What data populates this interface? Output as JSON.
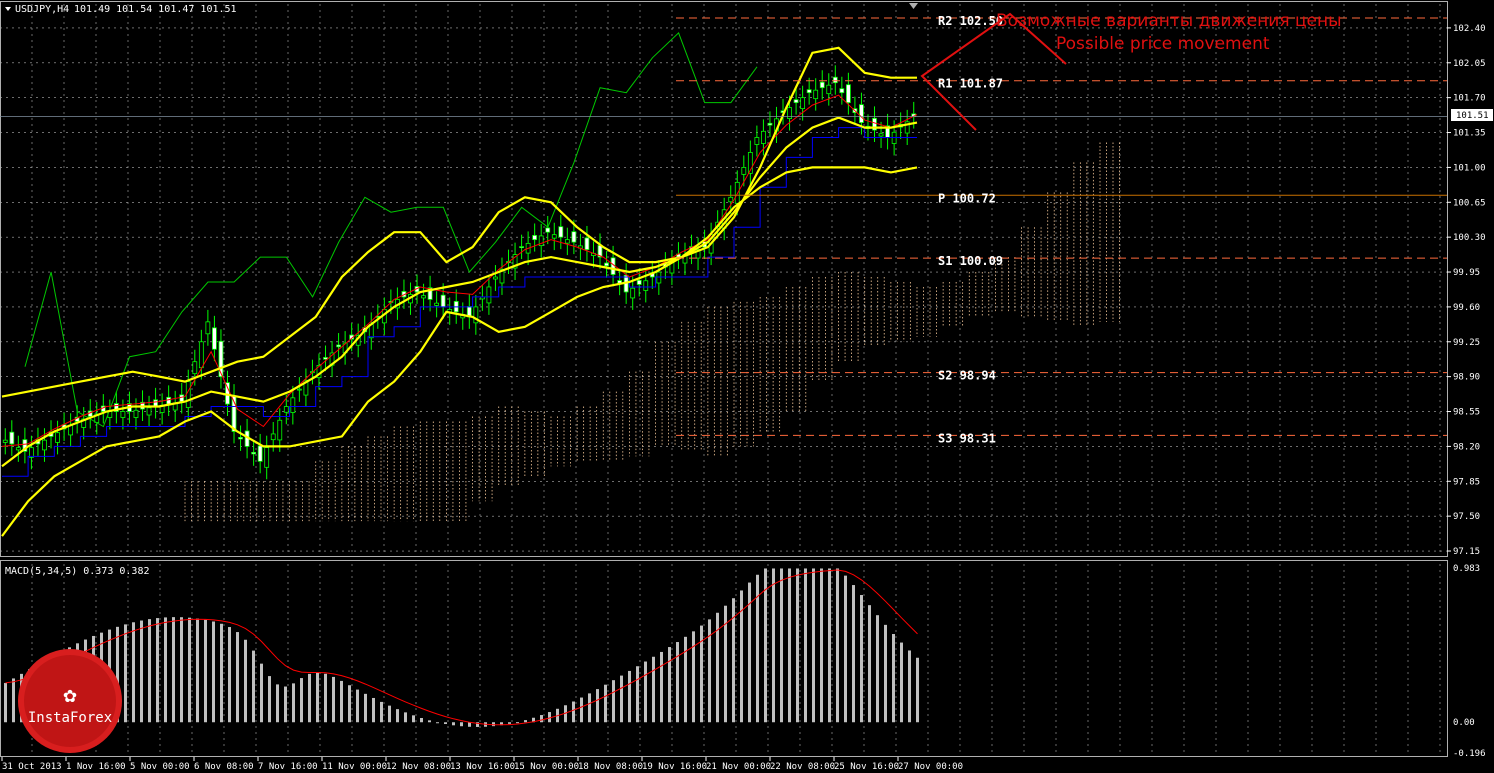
{
  "header": {
    "symbol_label": "USDJPY,H4",
    "ohlc": "101.49 101.54 101.47 101.51"
  },
  "levels": [
    {
      "label": "R2 102.50",
      "value": 102.5
    },
    {
      "label": "R1 101.87",
      "value": 101.87
    },
    {
      "label": "P 100.72",
      "value": 100.72
    },
    {
      "label": "S1 100.09",
      "value": 100.09
    },
    {
      "label": "S2 98.94",
      "value": 98.94
    },
    {
      "label": "S3 98.31",
      "value": 98.31
    }
  ],
  "annotation": {
    "line1": "Возможные варианты движения цены",
    "line2": "Possible price movement",
    "color": "#e01010"
  },
  "current_price": {
    "label": "101.51",
    "value": 101.51
  },
  "macd": {
    "label": "MACD(5,34,5) 0.373 0.382",
    "ticks": [
      "0.983",
      "0.00",
      "-0.196"
    ]
  },
  "logo": {
    "text": "InstaForex"
  },
  "colors": {
    "grid": "#b0b0b0",
    "bollinger": "#ffff00",
    "kijun": "#0000ff",
    "tenkan": "#ff0000",
    "chikou": "#00c800",
    "cloud": "#f5c89a",
    "candle": "#00ff00",
    "pivot": "#c87000",
    "sr": "#ff6a3c",
    "macd_hist": "#c0c0c0",
    "macd_signal": "#ff0000"
  },
  "chart_data": {
    "type": "line",
    "title": "USDJPY,H4",
    "price_axis_ticks": [
      "102.40",
      "102.05",
      "101.70",
      "101.35",
      "101.00",
      "100.65",
      "100.30",
      "99.95",
      "99.60",
      "99.25",
      "98.90",
      "98.55",
      "98.20",
      "97.85",
      "97.50",
      "97.15"
    ],
    "ylim": [
      97.1,
      102.64
    ],
    "x_ticks": [
      "31 Oct 2013",
      "1 Nov 16:00",
      "5 Nov 00:00",
      "6 Nov 08:00",
      "7 Nov 16:00",
      "11 Nov 00:00",
      "12 Nov 08:00",
      "13 Nov 16:00",
      "15 Nov 00:00",
      "18 Nov 08:00",
      "19 Nov 16:00",
      "21 Nov 00:00",
      "22 Nov 08:00",
      "25 Nov 16:00",
      "27 Nov 00:00"
    ],
    "grid": true,
    "series": [
      {
        "name": "Price (close)",
        "values": [
          98.3,
          98.15,
          98.3,
          98.45,
          98.55,
          98.55,
          98.6,
          98.65,
          99.45,
          98.35,
          98.05,
          98.6,
          98.95,
          99.2,
          99.35,
          99.65,
          99.75,
          99.6,
          99.5,
          99.9,
          100.2,
          100.35,
          100.25,
          100.1,
          99.75,
          99.9,
          100.1,
          100.2,
          100.7,
          101.3,
          101.55,
          101.75,
          101.85,
          101.45,
          101.3,
          101.51
        ]
      },
      {
        "name": "Bollinger upper",
        "values": [
          98.7,
          98.75,
          98.8,
          98.85,
          98.9,
          98.95,
          98.9,
          98.85,
          98.95,
          99.05,
          99.1,
          99.3,
          99.5,
          99.9,
          100.15,
          100.35,
          100.35,
          100.05,
          100.2,
          100.55,
          100.7,
          100.65,
          100.4,
          100.2,
          100.05,
          100.05,
          100.1,
          100.2,
          100.5,
          101.0,
          101.6,
          102.15,
          102.2,
          101.95,
          101.9,
          101.9
        ]
      },
      {
        "name": "Bollinger middle",
        "values": [
          98.0,
          98.2,
          98.35,
          98.45,
          98.55,
          98.6,
          98.6,
          98.65,
          98.75,
          98.7,
          98.65,
          98.75,
          98.9,
          99.1,
          99.4,
          99.6,
          99.75,
          99.8,
          99.85,
          99.95,
          100.05,
          100.1,
          100.05,
          100.0,
          99.95,
          100.0,
          100.1,
          100.25,
          100.55,
          100.9,
          101.2,
          101.4,
          101.5,
          101.4,
          101.4,
          101.45
        ]
      },
      {
        "name": "Bollinger lower",
        "values": [
          97.3,
          97.65,
          97.9,
          98.05,
          98.2,
          98.25,
          98.3,
          98.45,
          98.55,
          98.35,
          98.2,
          98.2,
          98.25,
          98.3,
          98.65,
          98.85,
          99.15,
          99.55,
          99.5,
          99.35,
          99.4,
          99.55,
          99.7,
          99.8,
          99.85,
          99.95,
          100.1,
          100.3,
          100.6,
          100.8,
          100.95,
          101.0,
          101.0,
          101.0,
          100.95,
          101.0
        ]
      }
    ]
  }
}
